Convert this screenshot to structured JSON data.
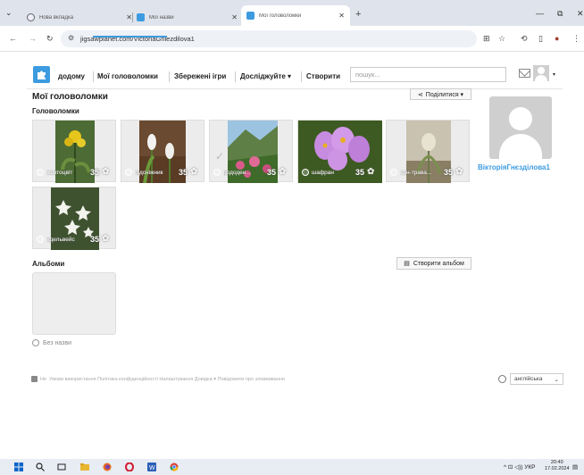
{
  "browser": {
    "tabs": [
      {
        "title": "Нова вкладка",
        "icon": "globe-icon"
      },
      {
        "title": "Мої назви",
        "icon": "puzzle-icon"
      },
      {
        "title": "Мої головоломки",
        "icon": "puzzle-icon",
        "active": true
      }
    ],
    "new_tab": "+",
    "url": "jigsawplanet.com/VictoriaGniezdilova1"
  },
  "header": {
    "nav": {
      "home": "додому",
      "my_puzzles": "Мої головоломки",
      "saved_games": "Збережені ігри",
      "explore": "Досліджуйте ▾",
      "create": "Створити"
    },
    "search_placeholder": "пошук...",
    "user_caret": "▾"
  },
  "main": {
    "page_title": "Мої головоломки",
    "share_label": "Поділитися ▾",
    "puzzles_heading": "Головоломки",
    "puzzles": [
      {
        "caption": "жовтоцвіт",
        "count": "35",
        "photo": "yellow-flower"
      },
      {
        "caption": "підсніжник",
        "count": "35",
        "photo": "snowdrop"
      },
      {
        "caption": "рододен...",
        "count": "35",
        "photo": "rhododendron",
        "checked": true
      },
      {
        "caption": "шафран",
        "count": "35",
        "photo": "crocus"
      },
      {
        "caption": "сон-трава...",
        "count": "35",
        "photo": "pasque-flower"
      },
      {
        "caption": "едельвейс",
        "count": "35",
        "photo": "edelweiss"
      }
    ],
    "albums_heading": "Альбоми",
    "create_album_label": "Створити альбом",
    "album_untitled": "Без назви"
  },
  "profile": {
    "username": "ВікторіяГнєзділова1"
  },
  "footer": {
    "links": "Умови використання  Політика конфіденційності  Налаштування  Довідка ▾  Повідомити про зловживання",
    "fb_label": "Не",
    "language": "англійська"
  },
  "taskbar": {
    "tray": "^ ⊡ ◁)) УКР",
    "time": "20:40",
    "date": "17.02.2024"
  },
  "colors": {
    "accent": "#3d9be0",
    "username": "#3d9be0"
  }
}
